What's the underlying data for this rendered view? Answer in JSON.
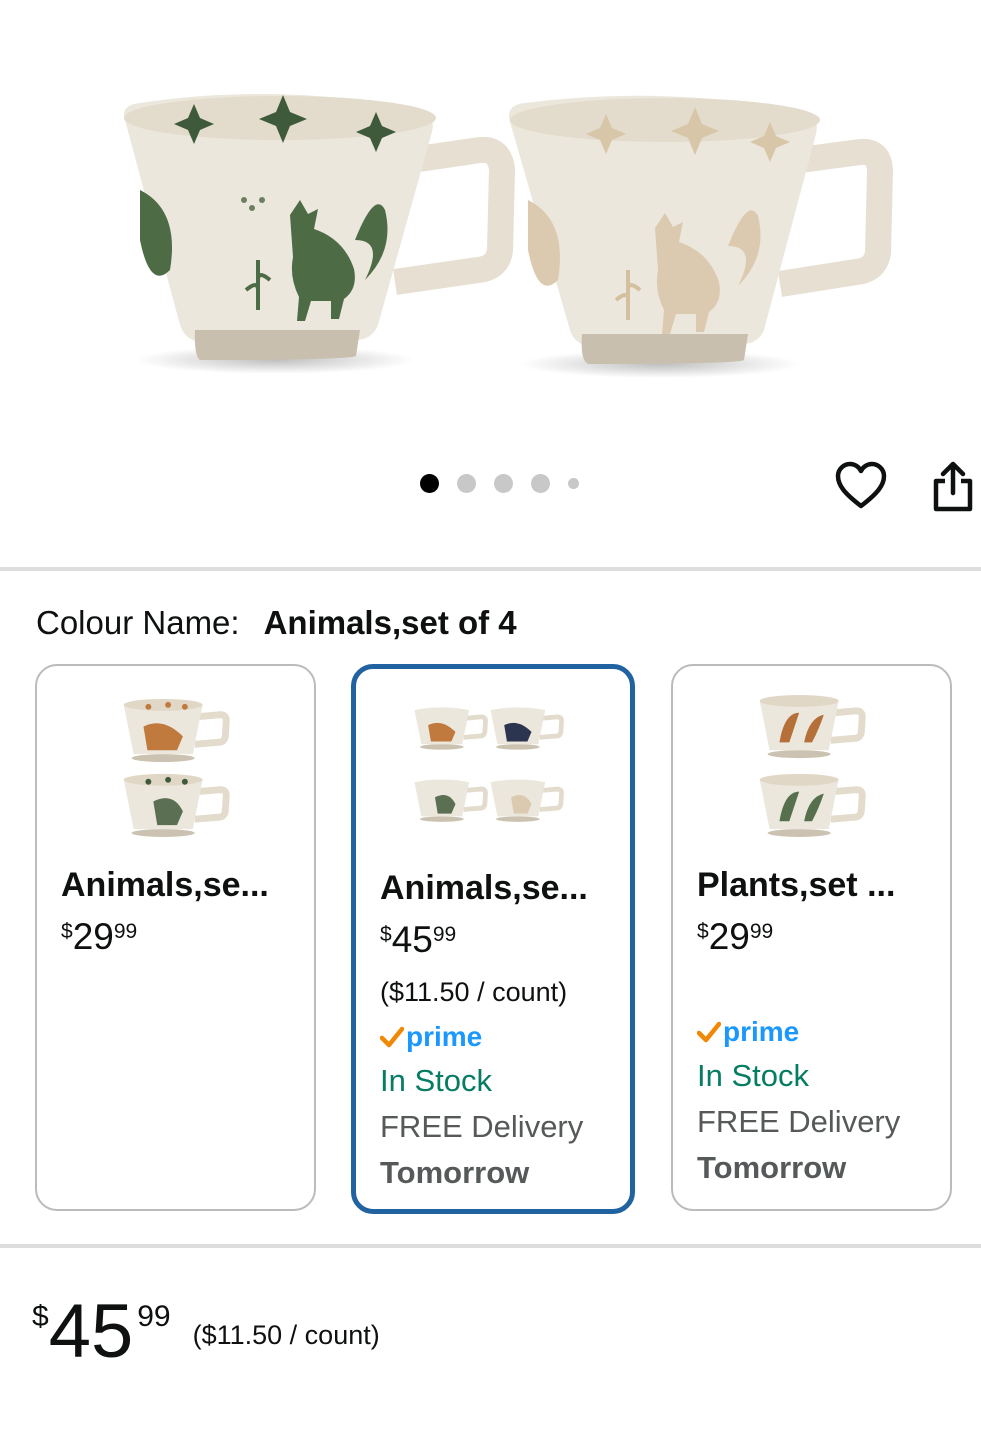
{
  "gallery": {
    "image_alt_icon": "product-image-mugs",
    "dot_count": 5,
    "active_dot": 0
  },
  "actions": {
    "wishlist_icon": "heart-icon",
    "share_icon": "share-icon"
  },
  "colour": {
    "label": "Colour Name:",
    "value": "Animals,set of 4"
  },
  "variants": [
    {
      "name": "Animals,se...",
      "price_symbol": "$",
      "price_whole": "29",
      "price_fraction": "99",
      "selected": false
    },
    {
      "name": "Animals,se...",
      "price_symbol": "$",
      "price_whole": "45",
      "price_fraction": "99",
      "unit_price": "($11.50 / count)",
      "prime": "prime",
      "stock": "In Stock",
      "delivery": "FREE Delivery",
      "delivery_day": "Tomorrow",
      "selected": true
    },
    {
      "name": "Plants,set ...",
      "price_symbol": "$",
      "price_whole": "29",
      "price_fraction": "99",
      "prime": "prime",
      "stock": "In Stock",
      "delivery": "FREE Delivery",
      "delivery_day": "Tomorrow",
      "selected": false
    }
  ],
  "summary": {
    "price_symbol": "$",
    "price_whole": "45",
    "price_fraction": "99",
    "unit_price": "($11.50 / count)"
  },
  "colors": {
    "selected_border": "#2162a1",
    "in_stock": "#067d62",
    "prime_blue": "#1a98ff",
    "prime_check": "#f08804"
  }
}
